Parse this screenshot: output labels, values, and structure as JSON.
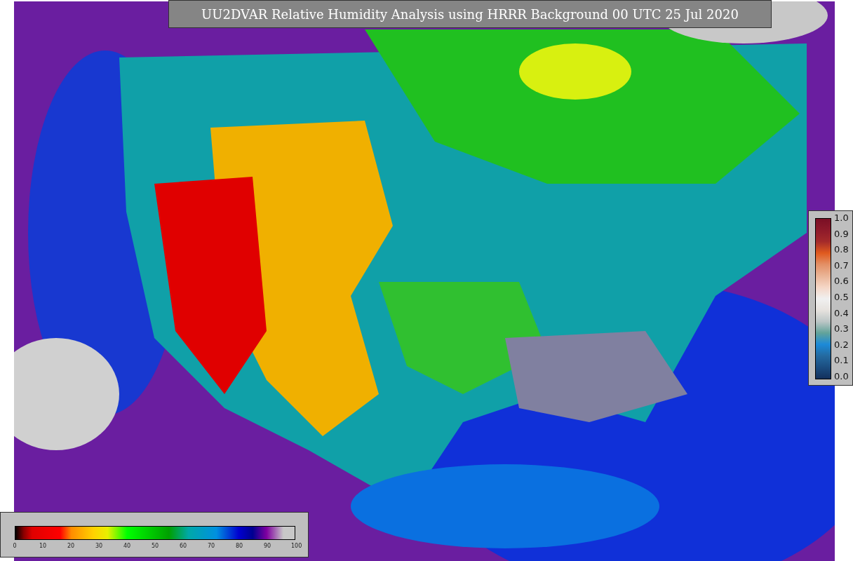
{
  "title": "UU2DVAR Relative Humidity Analysis using HRRR Background 00 UTC 25 Jul 2020",
  "observation_colorbar": {
    "ticks": [
      "1.0",
      "0.9",
      "0.8",
      "0.7",
      "0.6",
      "0.5",
      "0.4",
      "0.3",
      "0.2",
      "0.1",
      "0.0"
    ]
  },
  "humidity_colorbar": {
    "ticks": [
      "0",
      "10",
      "20",
      "30",
      "40",
      "50",
      "60",
      "70",
      "80",
      "90",
      "100"
    ]
  }
}
